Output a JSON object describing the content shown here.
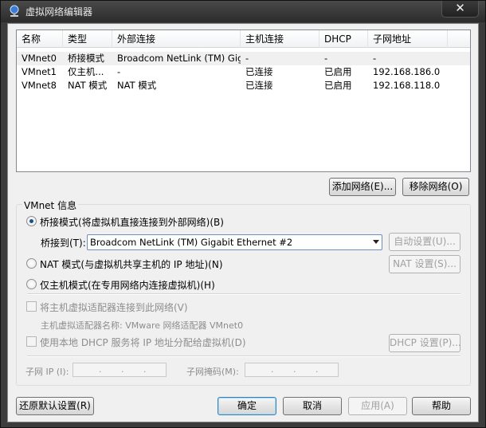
{
  "window": {
    "title": "虚拟网络编辑器",
    "close_glyph": "✕"
  },
  "list": {
    "columns": [
      "名称",
      "类型",
      "外部连接",
      "主机连接",
      "DHCP",
      "子网地址"
    ],
    "rows": [
      {
        "name": "VMnet0",
        "type": "桥接模式",
        "external": "Broadcom NetLink (TM) Giga...",
        "host": "-",
        "dhcp": "-",
        "subnet": "-"
      },
      {
        "name": "VMnet1",
        "type": "仅主机...",
        "external": "-",
        "host": "已连接",
        "dhcp": "已启用",
        "subnet": "192.168.186.0"
      },
      {
        "name": "VMnet8",
        "type": "NAT 模式",
        "external": "NAT 模式",
        "host": "已连接",
        "dhcp": "已启用",
        "subnet": "192.168.118.0"
      }
    ]
  },
  "buttons": {
    "add_network": "添加网络(E)...",
    "remove_network": "移除网络(O)",
    "auto_settings": "自动设置(U)...",
    "nat_settings": "NAT 设置(S)...",
    "dhcp_settings": "DHCP 设置(P)...",
    "restore_defaults": "还原默认设置(R)",
    "ok": "确定",
    "cancel": "取消",
    "apply": "应用(A)",
    "help": "帮助"
  },
  "info": {
    "group_title": "VMnet 信息",
    "bridged_label": "桥接模式(将虚拟机直接连接到外部网络)(B)",
    "bridge_to_label": "桥接到(T):",
    "bridge_to_value": "Broadcom NetLink (TM) Gigabit Ethernet #2",
    "nat_label": "NAT 模式(与虚拟机共享主机的 IP 地址)(N)",
    "hostonly_label": "仅主机模式(在专用网络内连接虚拟机)(H)",
    "connect_adapter_label": "将主机虚拟适配器连接到此网络(V)",
    "adapter_name_label": "主机虚拟适配器名称: VMware 网络适配器 VMnet0",
    "use_dhcp_label": "使用本地 DHCP 服务将 IP 地址分配给虚拟机(D)",
    "subnet_ip_label": "子网 IP (I):",
    "subnet_mask_label": "子网掩码(M):",
    "selected_mode": "bridged"
  }
}
